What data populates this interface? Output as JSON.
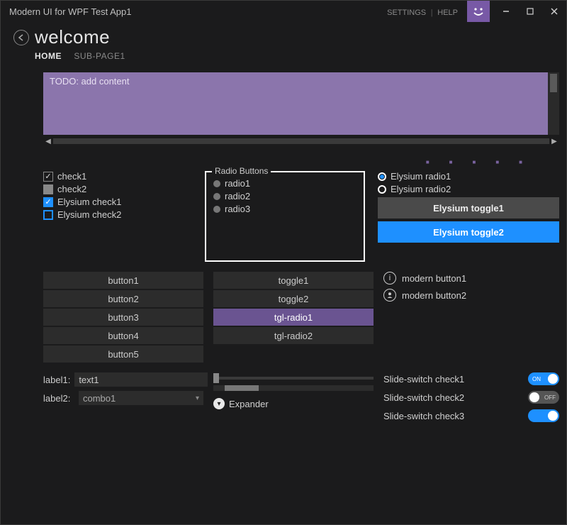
{
  "titlebar": {
    "title": "Modern UI for WPF Test App1",
    "settings": "SETTINGS",
    "help": "HELP"
  },
  "header": {
    "title": "welcome",
    "tabs": [
      "HOME",
      "SUB-PAGE1"
    ]
  },
  "todo": "TODO: add content",
  "checks": {
    "c1": "check1",
    "c2": "check2",
    "c3": "Elysium check1",
    "c4": "Elysium check2"
  },
  "radio": {
    "legend": "Radio Buttons",
    "r1": "radio1",
    "r2": "radio2",
    "r3": "radio3"
  },
  "ely": {
    "r1": "Elysium radio1",
    "r2": "Elysium radio2",
    "t1": "Elysium toggle1",
    "t2": "Elysium toggle2"
  },
  "buttons": {
    "b1": "button1",
    "b2": "button2",
    "b3": "button3",
    "b4": "button4",
    "b5": "button5"
  },
  "toggles": {
    "t1": "toggle1",
    "t2": "toggle2",
    "tr1": "tgl-radio1",
    "tr2": "tgl-radio2"
  },
  "modern": {
    "m1": "modern button1",
    "m2": "modern button2"
  },
  "form": {
    "label1": "label1:",
    "text1": "text1",
    "label2": "label2:",
    "combo1": "combo1",
    "expander": "Expander"
  },
  "switches": {
    "s1": "Slide-switch check1",
    "s1v": "ON",
    "s2": "Slide-switch check2",
    "s2v": "OFF",
    "s3": "Slide-switch check3"
  }
}
